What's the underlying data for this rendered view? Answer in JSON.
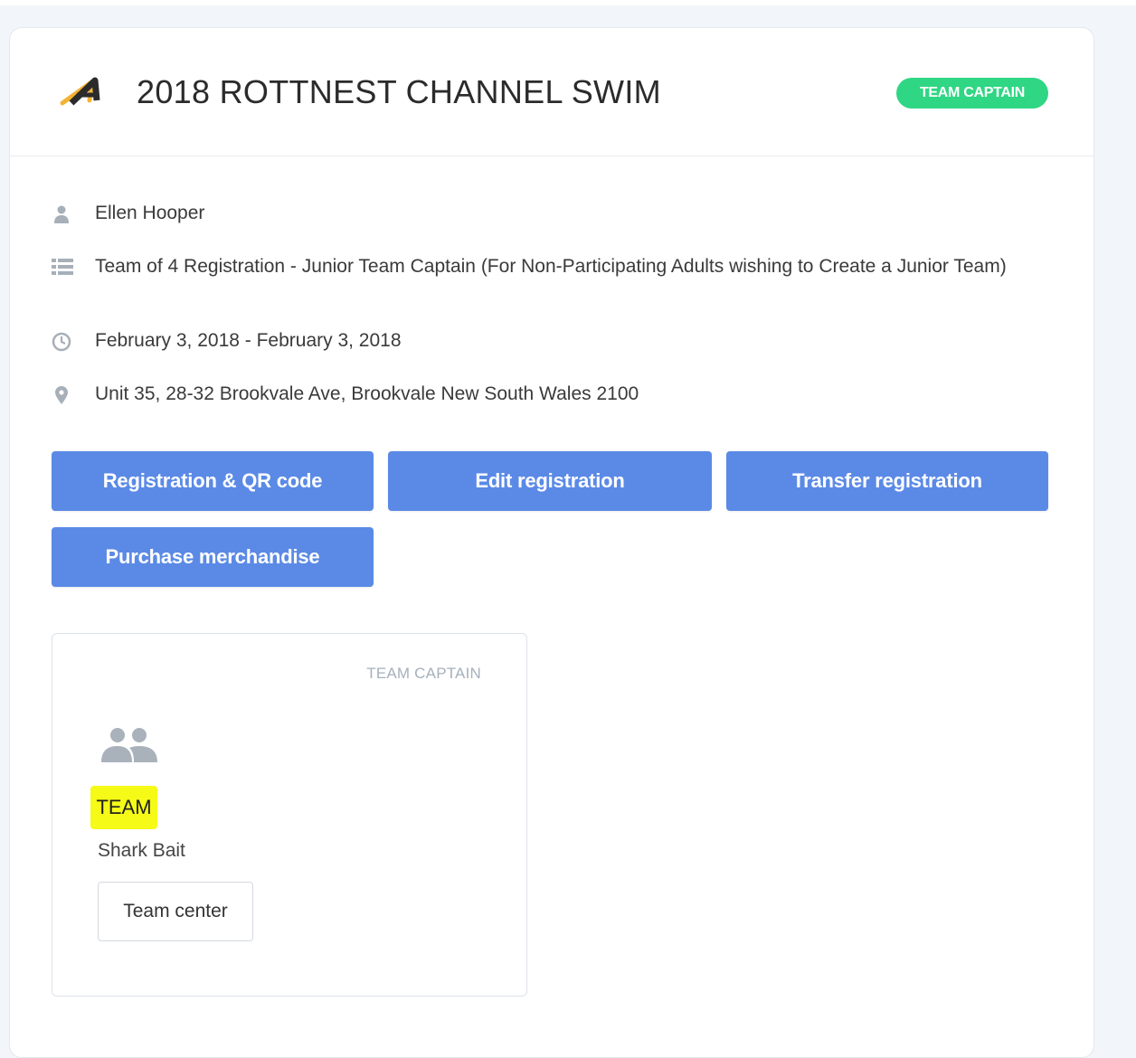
{
  "event": {
    "title": "2018 ROTTNEST CHANNEL SWIM",
    "role_badge": "TEAM CAPTAIN",
    "colors": {
      "badge": "#2fd684",
      "button": "#5b8ae6",
      "highlight": "#f5fb16"
    }
  },
  "info": {
    "name": "Ellen Hooper",
    "registration_type": "Team of 4 Registration - Junior Team Captain (For Non-Participating Adults wishing to Create a Junior Team)",
    "dates": "February 3, 2018 - February 3, 2018",
    "address": "Unit 35, 28-32 Brookvale Ave, Brookvale New South Wales 2100"
  },
  "actions": {
    "registration_qr": "Registration & QR code",
    "edit_registration": "Edit registration",
    "transfer_registration": "Transfer registration",
    "purchase_merchandise": "Purchase merchandise"
  },
  "team_card": {
    "role": "TEAM CAPTAIN",
    "label": "TEAM",
    "name": "Shark Bait",
    "center_button": "Team center"
  },
  "icons": [
    "event-logo-icon",
    "user-icon",
    "list-icon",
    "clock-icon",
    "map-pin-icon",
    "team-people-icon"
  ]
}
